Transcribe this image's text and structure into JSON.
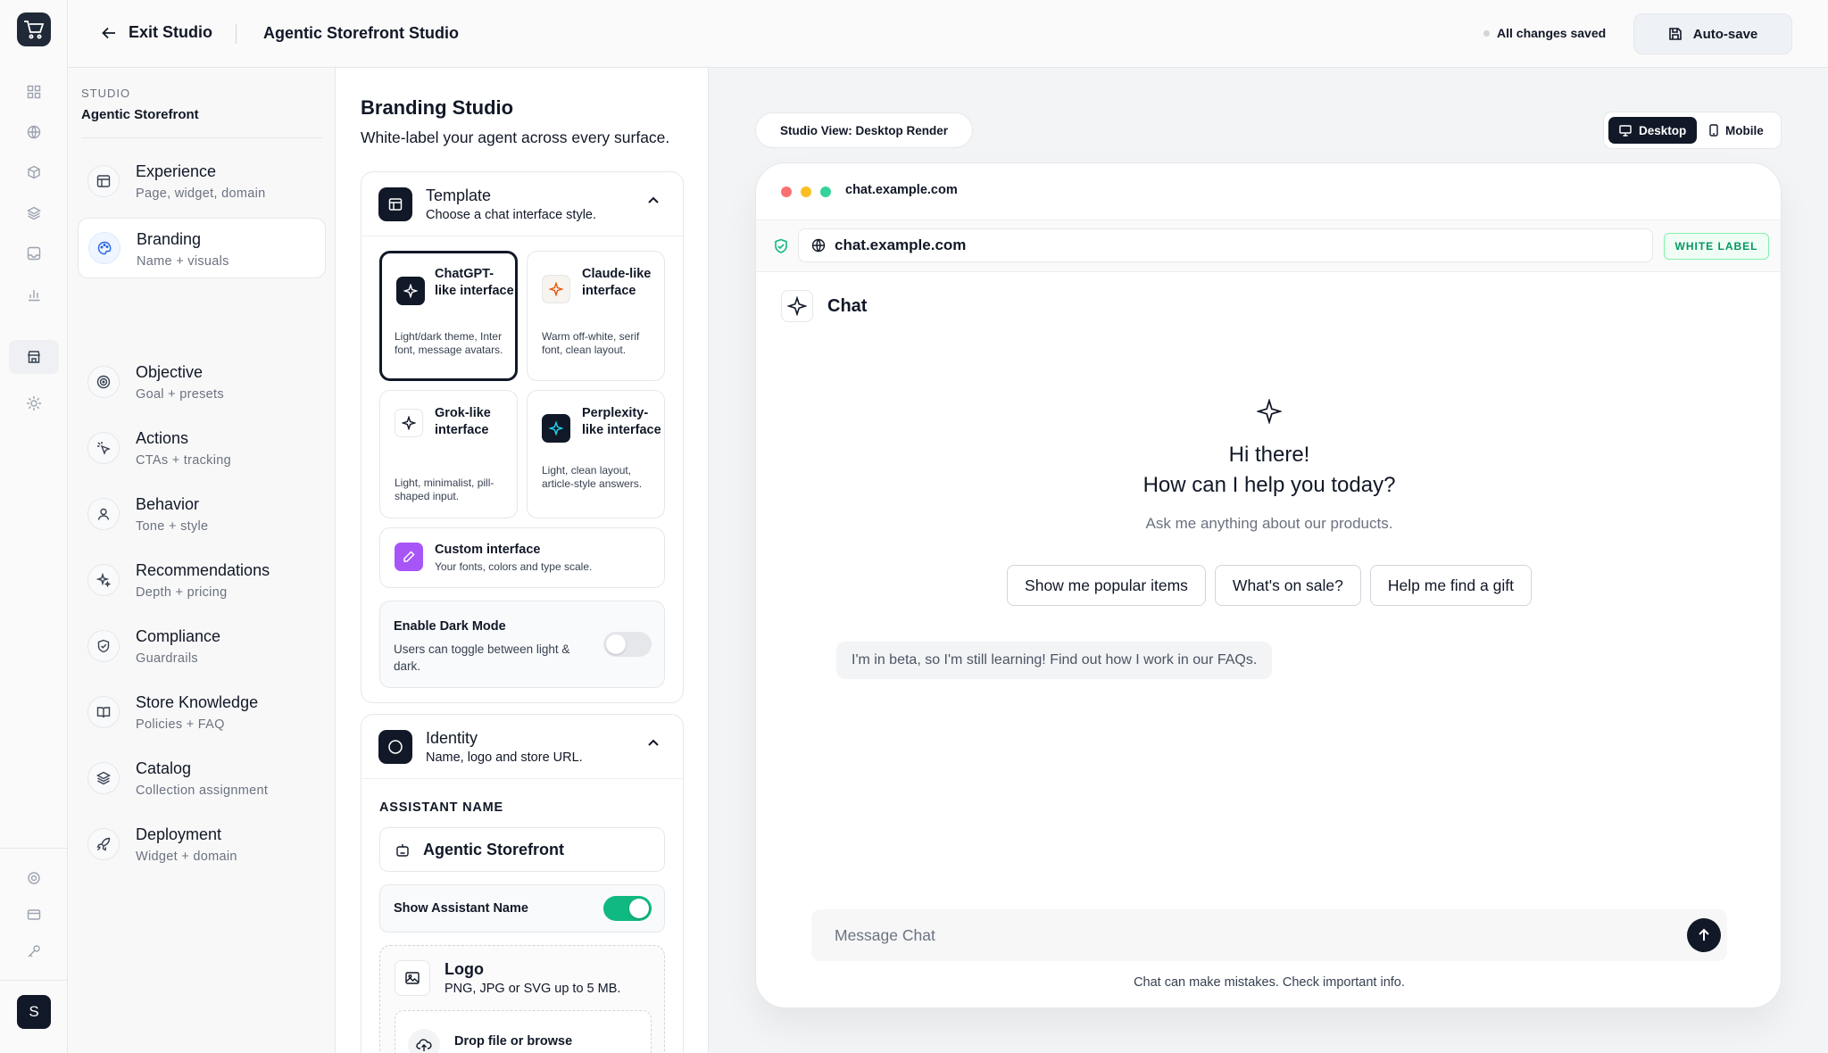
{
  "topbar": {
    "exit_label": "Exit Studio",
    "title": "Agentic Storefront Studio",
    "status": "All changes saved",
    "autosave_label": "Auto-save"
  },
  "rail": {
    "avatar_initial": "S",
    "icons": [
      "cart-logo-icon",
      "grid-icon",
      "globe-icon",
      "cube-icon",
      "layers-icon",
      "inbox-icon",
      "bar-chart-icon",
      "storefront-icon",
      "sparkle-settings-icon",
      "gear-icon",
      "card-icon",
      "key-icon"
    ]
  },
  "nav": {
    "section_label": "STUDIO",
    "store_name": "Agentic Storefront",
    "items": [
      {
        "title": "Experience",
        "subtitle": "Page, widget, domain"
      },
      {
        "title": "Branding",
        "subtitle": "Name + visuals"
      },
      {
        "title": "Objective",
        "subtitle": "Goal + presets"
      },
      {
        "title": "Actions",
        "subtitle": "CTAs + tracking"
      },
      {
        "title": "Behavior",
        "subtitle": "Tone + style"
      },
      {
        "title": "Recommendations",
        "subtitle": "Depth + pricing"
      },
      {
        "title": "Compliance",
        "subtitle": "Guardrails"
      },
      {
        "title": "Store Knowledge",
        "subtitle": "Policies + FAQ"
      },
      {
        "title": "Catalog",
        "subtitle": "Collection assignment"
      },
      {
        "title": "Deployment",
        "subtitle": "Widget + domain"
      }
    ]
  },
  "panel": {
    "title": "Branding Studio",
    "subtitle": "White-label your agent across every surface.",
    "template": {
      "title": "Template",
      "subtitle": "Choose a chat interface style.",
      "options": [
        {
          "name": "ChatGPT-like interface",
          "desc": "Light/dark theme, Inter font, message avatars."
        },
        {
          "name": "Claude-like interface",
          "desc": "Warm off-white, serif font, clean layout."
        },
        {
          "name": "Grok-like interface",
          "desc": "Light, minimalist, pill-shaped input."
        },
        {
          "name": "Perplexity-like interface",
          "desc": "Light, clean layout, article-style answers."
        }
      ],
      "custom": {
        "name": "Custom interface",
        "desc": "Your fonts, colors and type scale."
      },
      "dark_mode": {
        "title": "Enable Dark Mode",
        "desc": "Users can toggle between light & dark.",
        "enabled": false
      }
    },
    "identity": {
      "title": "Identity",
      "subtitle": "Name, logo and store URL.",
      "assistant_name_label": "ASSISTANT NAME",
      "assistant_name_value": "Agentic Storefront",
      "show_name_label": "Show Assistant Name",
      "show_name_enabled": true,
      "logo_title": "Logo",
      "logo_hint": "PNG, JPG or SVG up to 5 MB.",
      "drop_label": "Drop file or browse"
    }
  },
  "preview": {
    "view_label": "Studio View: Desktop Render",
    "devices": [
      "Desktop",
      "Mobile"
    ],
    "selected_device": "Desktop",
    "browser_host": "chat.example.com",
    "url": "chat.example.com",
    "badge": "WHITE LABEL",
    "chat_title": "Chat",
    "greeting_line1": "Hi there!",
    "greeting_line2": "How can I help you today?",
    "greeting_sub": "Ask me anything about our products.",
    "chips": [
      "Show me popular items",
      "What's on sale?",
      "Help me find a gift"
    ],
    "beta_note": "I'm in beta, so I'm still learning! Find out how I work in our FAQs.",
    "composer_placeholder": "Message Chat",
    "disclaimer": "Chat can make mistakes. Check important info."
  },
  "colors": {
    "accent_dark": "#111827",
    "toggle_on": "#10b981",
    "badge_green": "#059669",
    "custom_purple": "#a855f7",
    "dot_red": "#f87171",
    "dot_yellow": "#fbbf24",
    "dot_green": "#34d399"
  }
}
